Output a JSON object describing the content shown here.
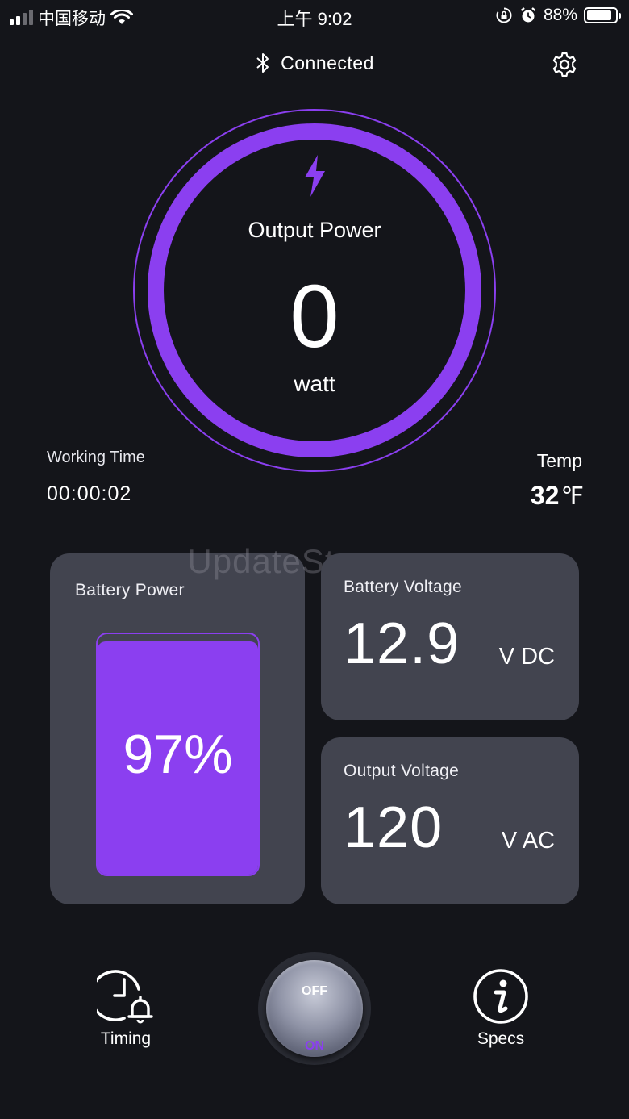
{
  "status_bar": {
    "carrier": "中国移动",
    "time": "上午 9:02",
    "battery_percent": "88%",
    "battery_level": 0.88,
    "icons": [
      "signal-icon",
      "wifi-icon",
      "orientation-lock-icon",
      "alarm-icon",
      "battery-icon"
    ]
  },
  "header": {
    "connection_status": "Connected",
    "connection_icon": "bluetooth-icon",
    "settings_icon": "gear-icon"
  },
  "gauge": {
    "title": "Output Power",
    "value": "0",
    "unit": "watt",
    "icon": "lightning-bolt-icon",
    "accent_color": "#8b3ff0"
  },
  "working_time": {
    "label": "Working Time",
    "value": "00:00:02"
  },
  "temperature": {
    "label": "Temp",
    "value": "32",
    "unit": "℉"
  },
  "watermark": "UpdateStar.com",
  "battery_power": {
    "label": "Battery Power",
    "percent_text": "97%",
    "level": 0.97
  },
  "battery_voltage": {
    "label": "Battery Voltage",
    "value": "12.9",
    "unit": "V DC"
  },
  "output_voltage": {
    "label": "Output Voltage",
    "value": "120",
    "unit": "V AC"
  },
  "bottom_nav": {
    "timing_label": "Timing",
    "timing_icon": "clock-alarm-icon",
    "specs_label": "Specs",
    "specs_icon": "info-icon",
    "switch_off_label": "OFF",
    "switch_on_label": "ON"
  },
  "colors": {
    "background": "#14151a",
    "card": "#42444f",
    "accent": "#8b3ff0"
  }
}
